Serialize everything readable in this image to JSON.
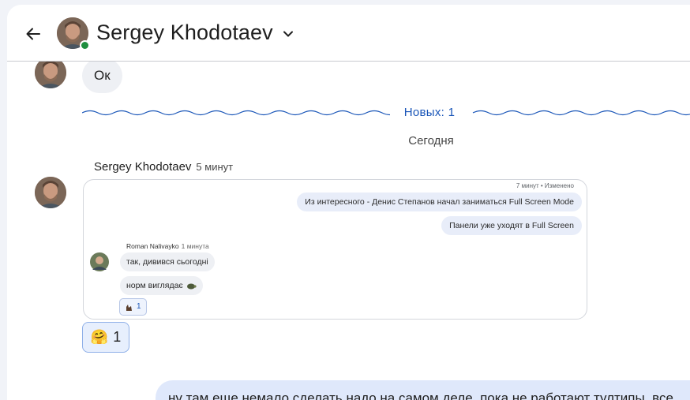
{
  "header": {
    "back_icon": "arrow-back-icon",
    "contact_name": "Sergey Khodotaev",
    "status": "online",
    "status_color": "#1e8e3e",
    "menu_icon": "chevron-down-icon"
  },
  "messages": {
    "prev_text": "Ок",
    "new_divider": "Новых: 1",
    "date_divider": "Сегодня",
    "sender_name": "Sergey Khodotaev",
    "sender_time": "5 минут",
    "reaction": {
      "emoji": "🤗",
      "count": "1"
    },
    "outgoing_text": "ну там еще немало сделать надо на самом деле, пока не работают тултипы, все"
  },
  "screenshot": {
    "meta": "7 минут • Изменено",
    "outgoing_1": "Из интересного - Денис Степанов начал заниматься Full Screen Mode",
    "outgoing_2": "Панели уже уходят в Full Screen",
    "sender": "Roman Nalivayko",
    "sender_time": "1 минута",
    "incoming_1": "так, дивився сьогодні",
    "incoming_2": "норм виглядає",
    "reaction_count": "1"
  },
  "colors": {
    "accent": "#1a56b8",
    "outgoing_bubble": "#dfe8fb",
    "incoming_bubble": "#eef0f4",
    "divider_wave": "#1a56b8"
  }
}
